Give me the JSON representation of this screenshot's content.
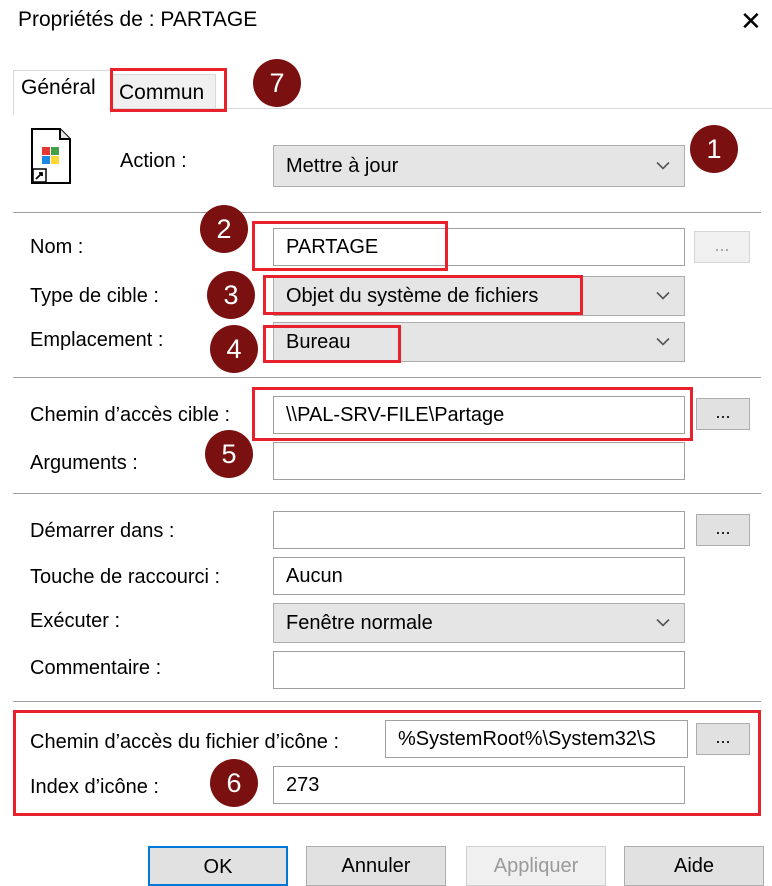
{
  "window": {
    "title": "Propriétés de : PARTAGE",
    "close_glyph": "✕"
  },
  "tabs": [
    {
      "label": "Général"
    },
    {
      "label": "Commun"
    }
  ],
  "badges": [
    "1",
    "2",
    "3",
    "4",
    "5",
    "6",
    "7"
  ],
  "colors": {
    "highlight": "#e8212c",
    "badge": "#7b1010",
    "default_button": "#0078d7"
  },
  "icons": {
    "file": "shortcut-file-icon",
    "chevron": "chevron-down-icon"
  },
  "action": {
    "label": "Action :",
    "value": "Mettre à jour"
  },
  "name": {
    "label": "Nom :",
    "value": "PARTAGE"
  },
  "target_type": {
    "label": "Type de cible :",
    "value": "Objet du système de fichiers"
  },
  "location": {
    "label": "Emplacement :",
    "value": "Bureau"
  },
  "target_path": {
    "label": "Chemin d’accès cible :",
    "value": "\\\\PAL-SRV-FILE\\Partage"
  },
  "arguments": {
    "label": "Arguments :",
    "value": ""
  },
  "start_in": {
    "label": "Démarrer dans :",
    "value": ""
  },
  "shortcut_key": {
    "label": "Touche de raccourci :",
    "value": "Aucun"
  },
  "run": {
    "label": "Exécuter :",
    "value": "Fenêtre normale"
  },
  "comment": {
    "label": "Commentaire :",
    "value": ""
  },
  "icon_path": {
    "label": "Chemin d’accès du fichier d’icône :",
    "value": "%SystemRoot%\\System32\\S"
  },
  "icon_index": {
    "label": "Index d’icône :",
    "value": "273"
  },
  "browse_label": "...",
  "buttons": {
    "ok": "OK",
    "cancel": "Annuler",
    "apply": "Appliquer",
    "help": "Aide"
  }
}
